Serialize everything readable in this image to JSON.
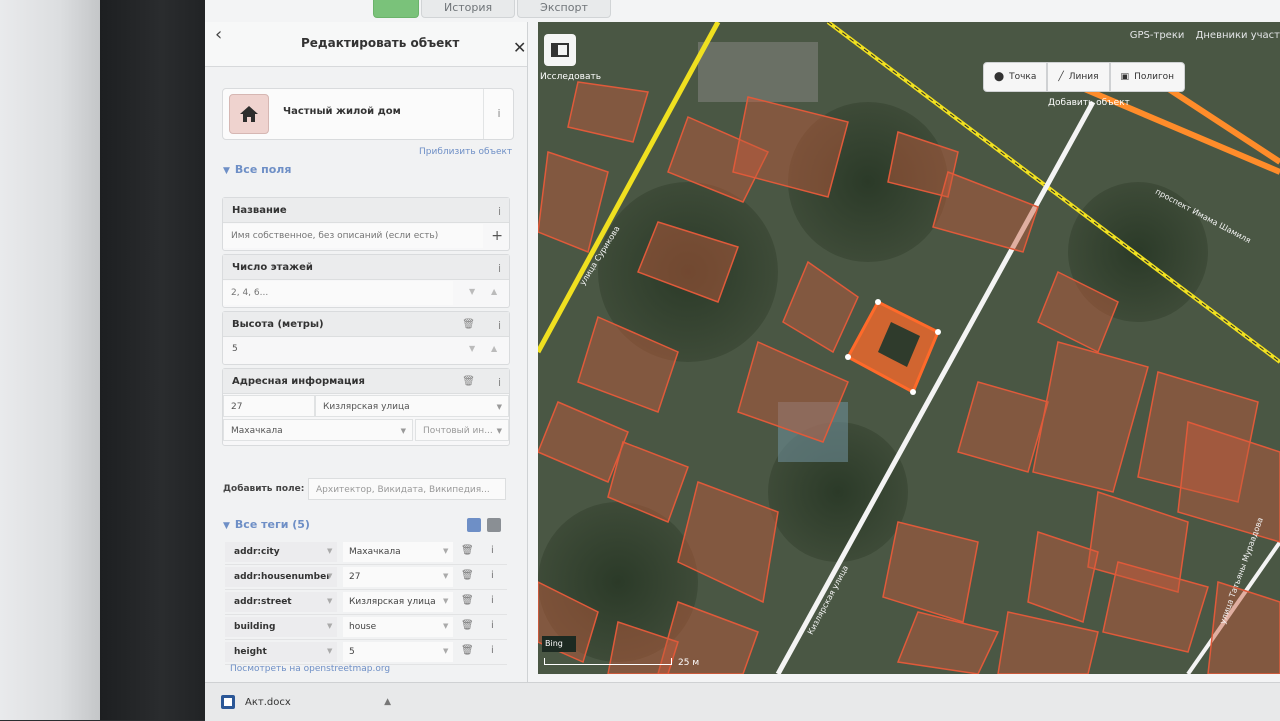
{
  "top_tabs": [
    "",
    "История",
    "Экспорт"
  ],
  "sidebar": {
    "title": "Редактировать объект",
    "preset_name": "Частный жилой дом",
    "zoom_link": "Приблизить объект",
    "all_fields_title": "Все поля",
    "fields": {
      "name": {
        "label": "Название",
        "placeholder": "Имя собственное, без описаний (если есть)"
      },
      "levels": {
        "label": "Число этажей",
        "placeholder": "2, 4, 6..."
      },
      "height": {
        "label": "Высота (метры)",
        "value": "5"
      },
      "address": {
        "label": "Адресная информация",
        "housenumber": "27",
        "street": "Кизлярская улица",
        "city": "Махачкала",
        "postcode_placeholder": "Почтовый ин..."
      }
    },
    "add_field_label": "Добавить поле:",
    "add_field_placeholder": "Архитектор, Викидата, Википедия...",
    "all_tags_title": "Все теги (5)",
    "tags": [
      {
        "key": "addr:city",
        "value": "Махачкала"
      },
      {
        "key": "addr:housenumber",
        "value": "27"
      },
      {
        "key": "addr:street",
        "value": "Кизлярская улица"
      },
      {
        "key": "building",
        "value": "house"
      },
      {
        "key": "height",
        "value": "5"
      }
    ],
    "osm_link": "Посмотреть на openstreetmap.org"
  },
  "map": {
    "top_links": [
      "GPS-треки",
      "Дневники участ"
    ],
    "explore_label": "Исследовать",
    "add_buttons": [
      "Точка",
      "Линия",
      "Полигон"
    ],
    "add_label": "Добавить объект",
    "bing_label": "Bing",
    "scale_label": "25 м",
    "street_labels": [
      "улица Сурикова",
      "Кизлярская улица",
      "проспект Имама Шамиля",
      "улица Татьяны Мураадова"
    ]
  },
  "taskbar": {
    "file_name": "Акт.docx"
  },
  "colors": {
    "accent_green": "#7ac27a",
    "link_blue": "#6e8fc6",
    "building_outline": "#e05a3a",
    "selected": "#ff6a2a"
  }
}
